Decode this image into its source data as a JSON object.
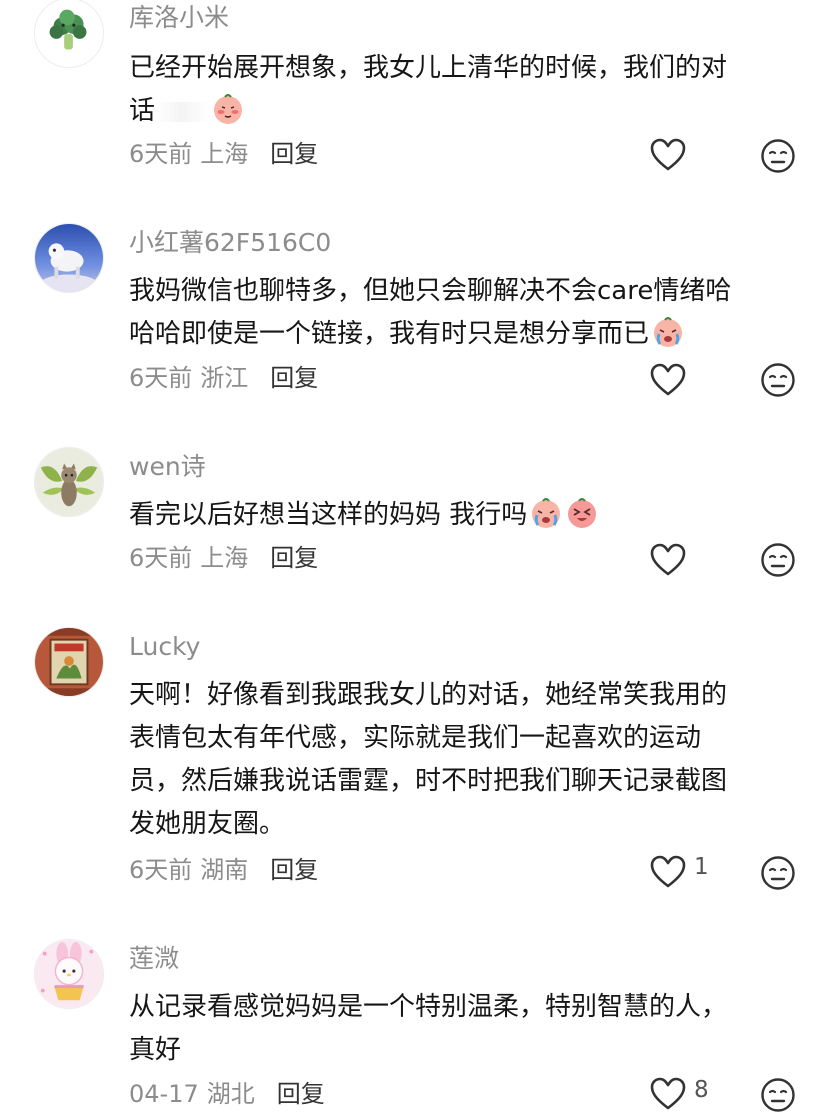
{
  "comments": [
    {
      "username": "库洛小米",
      "text_lines": [
        "已经开始展开想象，我女儿上清华的时候，我们的对",
        "话"
      ],
      "time": "6天前",
      "location": "上海",
      "reply_label": "回复",
      "likes": "",
      "avatar": "broccoli-avatar",
      "emojis": [
        "blush-emoji"
      ]
    },
    {
      "username": "小红薯62F516C0",
      "text_lines": [
        "我妈微信也聊特多，但她只会聊解决不会care情绪哈",
        "哈哈即使是一个链接，我有时只是想分享而已"
      ],
      "time": "6天前",
      "location": "浙江",
      "reply_label": "回复",
      "likes": "",
      "avatar": "robot-dog-avatar",
      "emojis": [
        "crying-emoji"
      ]
    },
    {
      "username": "wen诗",
      "text_lines": [
        "看完以后好想当这样的妈妈 我行吗"
      ],
      "time": "6天前",
      "location": "上海",
      "reply_label": "回复",
      "likes": "",
      "avatar": "cat-fairy-avatar",
      "emojis": [
        "crying-emoji",
        "excited-emoji"
      ]
    },
    {
      "username": "Lucky",
      "text_lines": [
        "天啊！好像看到我跟我女儿的对话，她经常笑我用的",
        "表情包太有年代感，实际就是我们一起喜欢的运动",
        "员，然后嫌我说话雷霆，时不时把我们聊天记录截图",
        "发她朋友圈。"
      ],
      "time": "6天前",
      "location": "湖南",
      "reply_label": "回复",
      "likes": "1",
      "avatar": "poster-avatar",
      "emojis": []
    },
    {
      "username": "莲溦",
      "text_lines": [
        "从记录看感觉妈妈是一个特别温柔，特别智慧的人，",
        "真好"
      ],
      "time": "04-17",
      "location": "湖北",
      "reply_label": "回复",
      "likes": "8",
      "avatar": "melody-avatar",
      "emojis": []
    }
  ],
  "icons": {
    "like": "heart-outline-icon",
    "dislike": "meh-face-icon"
  },
  "colors": {
    "username": "#8c8c8c",
    "text": "#161616",
    "meta": "#8c8c8c",
    "reply": "#333333",
    "icon": "#333333"
  }
}
